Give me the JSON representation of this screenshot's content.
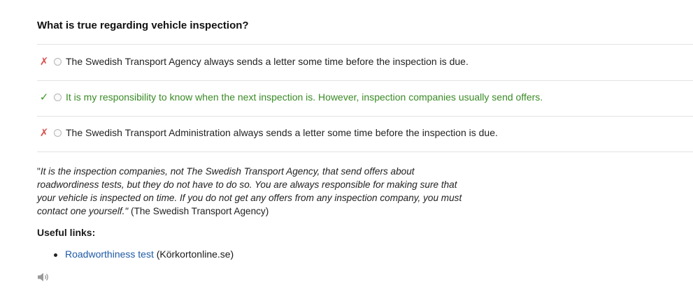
{
  "question": "What is true regarding vehicle inspection?",
  "options": [
    {
      "mark": "✗",
      "status": "wrong",
      "text": "The Swedish Transport Agency always sends a letter some time before the inspection is due."
    },
    {
      "mark": "✓",
      "status": "correct",
      "text": "It is my responsibility to know when the next inspection is. However, inspection companies usually send offers."
    },
    {
      "mark": "✗",
      "status": "wrong",
      "text": "The Swedish Transport Administration always sends a letter some time before the inspection is due."
    }
  ],
  "explanation": {
    "open_quote": "\"",
    "quote": "It is the inspection companies, not The Swedish Transport Agency, that send offers about roadwordiness tests, but they do not have to do so. You are always responsible for making sure that your vehicle is inspected on time. If you do not get any offers from any inspection company, you must contact one yourself.\"",
    "source": " (The Swedish Transport Agency)"
  },
  "useful_links": {
    "title": "Useful links:",
    "items": [
      {
        "link_text": "Roadworthiness test",
        "suffix": " (Körkortonline.se)"
      }
    ]
  },
  "icons": {
    "audio": "speaker-icon"
  },
  "colors": {
    "wrong_mark": "#d9534f",
    "correct_mark": "#3c9a2a",
    "correct_text": "#3a8a26",
    "link": "#1f5aa6"
  }
}
